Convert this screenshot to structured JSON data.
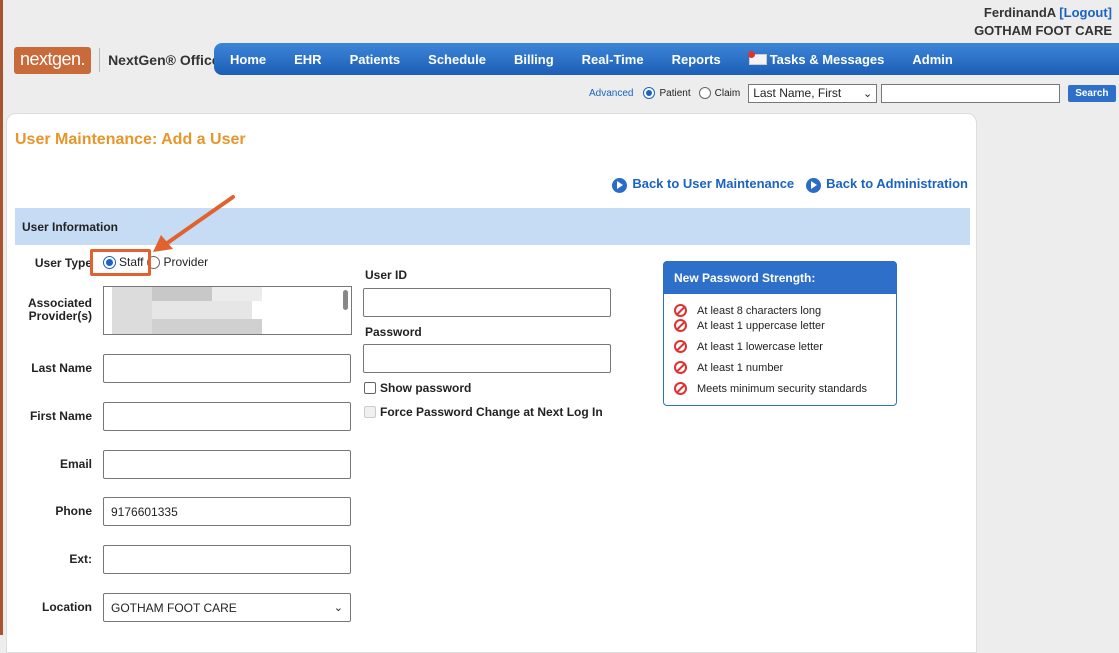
{
  "user": {
    "name": "FerdinandA",
    "logout": "[Logout]",
    "practice": "GOTHAM FOOT CARE"
  },
  "brand": {
    "logo": "nextgen.",
    "product": "NextGen® Office"
  },
  "nav": [
    {
      "label": "Home"
    },
    {
      "label": "EHR"
    },
    {
      "label": "Patients"
    },
    {
      "label": "Schedule"
    },
    {
      "label": "Billing"
    },
    {
      "label": "Real-Time"
    },
    {
      "label": "Reports"
    },
    {
      "label": "Tasks & Messages"
    },
    {
      "label": "Admin"
    }
  ],
  "search": {
    "advanced": "Advanced",
    "patient_label": "Patient",
    "claim_label": "Claim",
    "mode": "patient",
    "field_select": "Last Name, First",
    "query": "",
    "button": "Search"
  },
  "page": {
    "title": "User Maintenance: Add a User",
    "back_user": "Back to User Maintenance",
    "back_admin": "Back to Administration",
    "section": "User Information"
  },
  "form": {
    "user_type_label": "User Type",
    "staff": "Staff",
    "provider": "Provider",
    "user_type_selected": "staff",
    "assoc_label": "Associated Provider(s)",
    "last_name_label": "Last Name",
    "last_name": "",
    "first_name_label": "First Name",
    "first_name": "",
    "email_label": "Email",
    "email": "",
    "phone_label": "Phone",
    "phone": "9176601335",
    "ext_label": "Ext:",
    "ext": "",
    "location_label": "Location",
    "location": "GOTHAM FOOT CARE",
    "user_id_label": "User ID",
    "user_id": "",
    "password_label": "Password",
    "password": "",
    "show_password": "Show password",
    "force_change": "Force Password Change at Next Log In"
  },
  "strength": {
    "title": "New Password Strength:",
    "requirements": [
      "At least 8 characters long",
      "At least 1 uppercase letter",
      "At least 1 lowercase letter",
      "At least 1 number",
      "Meets minimum security standards"
    ]
  },
  "colors": {
    "accent": "#1a62c4",
    "title": "#e8962a",
    "annotation": "#e2622f",
    "section": "#c6dcf5"
  }
}
